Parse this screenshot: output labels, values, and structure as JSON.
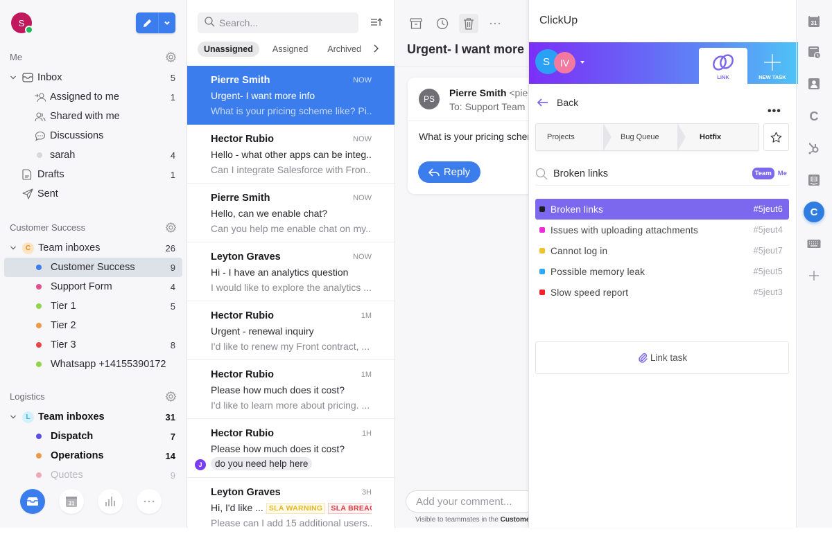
{
  "user": {
    "initial": "S"
  },
  "sidebar": {
    "me_header": "Me",
    "me_items": [
      {
        "label": "Inbox",
        "count": "5"
      },
      {
        "label": "Assigned to me",
        "count": "1"
      },
      {
        "label": "Shared with me",
        "count": ""
      },
      {
        "label": "Discussions",
        "count": ""
      },
      {
        "label": "sarah",
        "count": "4"
      },
      {
        "label": "Drafts",
        "count": "1"
      },
      {
        "label": "Sent",
        "count": ""
      }
    ],
    "cs_header": "Customer Success",
    "cs_group": {
      "badge": "C",
      "label": "Team inboxes",
      "count": "26"
    },
    "cs_items": [
      {
        "label": "Customer Success",
        "count": "9",
        "color": "#3b7ded"
      },
      {
        "label": "Support Form",
        "count": "4",
        "color": "#e0508c"
      },
      {
        "label": "Tier 1",
        "count": "5",
        "color": "#8fd44a"
      },
      {
        "label": "Tier 2",
        "count": "",
        "color": "#ea9a45"
      },
      {
        "label": "Tier 3",
        "count": "8",
        "color": "#e84646"
      },
      {
        "label": "Whatsapp +14155390172",
        "count": "",
        "color": "#8fd44a"
      }
    ],
    "log_header": "Logistics",
    "log_group": {
      "badge": "L",
      "label": "Team inboxes",
      "count": "31"
    },
    "log_items": [
      {
        "label": "Dispatch",
        "count": "7",
        "color": "#5a4fe0"
      },
      {
        "label": "Operations",
        "count": "14",
        "color": "#ea9a45"
      },
      {
        "label": "Quotes",
        "count": "9",
        "color": "#f0a8b8"
      }
    ],
    "bottom": {
      "calendar_day": "31"
    }
  },
  "list": {
    "search_placeholder": "Search...",
    "tabs": [
      "Unassigned",
      "Assigned",
      "Archived"
    ],
    "items": [
      {
        "from": "Pierre Smith",
        "time": "NOW",
        "subject": "Urgent- I want more info",
        "preview": "What is your pricing scheme like? Pi..."
      },
      {
        "from": "Hector Rubio",
        "time": "NOW",
        "subject": "Hello - what other apps can be integ...",
        "preview": "Can I integrate Salesforce with Fron..."
      },
      {
        "from": "Pierre Smith",
        "time": "NOW",
        "subject": "Hello, can we enable chat?",
        "preview": "Can you help me enable chat on my..."
      },
      {
        "from": "Leyton Graves",
        "time": "NOW",
        "subject": "Hi - I have an analytics question",
        "preview": "I would like to explore the analytics ..."
      },
      {
        "from": "Hector Rubio",
        "time": "1M",
        "subject": "Urgent - renewal inquiry",
        "preview": "I'd like to renew my Front contract, ..."
      },
      {
        "from": "Hector Rubio",
        "time": "1M",
        "subject": "Please how much does it cost?",
        "preview": "I'd like to learn more about pricing. ..."
      },
      {
        "from": "Hector Rubio",
        "time": "1H",
        "subject": "Please how much does it cost?",
        "comment_avatar": "J",
        "comment": "do you need help here"
      },
      {
        "from": "Leyton Graves",
        "time": "3H",
        "subject": "Hi, I'd like ...",
        "sla_warning": "SLA WARNING",
        "sla_breach": "SLA BREACH",
        "preview": "Please can I add 15 additional users..."
      }
    ]
  },
  "conversation": {
    "title": "Urgent- I want more info",
    "sender_initials": "PS",
    "sender_name": "Pierre Smith",
    "sender_email": "<pierre",
    "to": "To: Support Team",
    "body": "What is your pricing scheme like?",
    "reply_label": "Reply",
    "comment_placeholder": "Add your comment...",
    "visibility_prefix": "Visible to teammates in the ",
    "visibility_inbox": "Customer Success"
  },
  "clickup": {
    "title": "ClickUp",
    "avatars": [
      "S",
      "IV"
    ],
    "link_tab": "LINK",
    "new_task_tab": "NEW TASK",
    "back_label": "Back",
    "breadcrumbs": [
      "Projects",
      "Bug Queue",
      "Hotfix"
    ],
    "search_query": "Broken links",
    "filter_team": "Team",
    "filter_me": "Me",
    "tasks": [
      {
        "name": "Broken links",
        "id": "#5jeut6",
        "color": "#1f1f23"
      },
      {
        "name": "Issues with uploading attachments",
        "id": "#5jeut4",
        "color": "#f02bdc"
      },
      {
        "name": "Cannot log in",
        "id": "#5jeut7",
        "color": "#f2c12e"
      },
      {
        "name": "Possible memory leak",
        "id": "#5jeut5",
        "color": "#2ea6f5"
      },
      {
        "name": "Slow speed report",
        "id": "#5jeut3",
        "color": "#f0222a"
      }
    ],
    "link_task_label": "Link task",
    "accent": "#7b68ee"
  },
  "rail": {
    "calendar_day": "31",
    "clickup_letter": "C",
    "c_letter": "C"
  }
}
